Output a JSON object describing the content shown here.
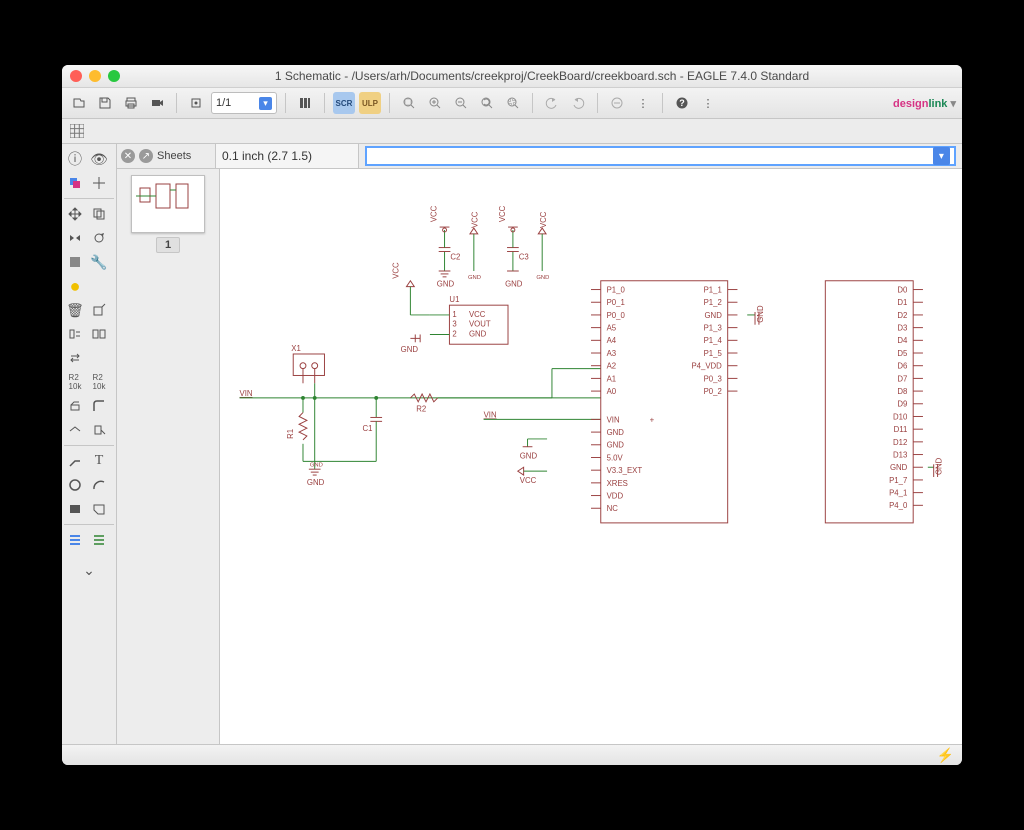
{
  "window": {
    "title": "1 Schematic - /Users/arh/Documents/creekproj/CreekBoard/creekboard.sch - EAGLE 7.4.0 Standard"
  },
  "toolbar": {
    "sheet_selector": "1/1",
    "designlink_label": "designlink"
  },
  "sheets": {
    "header": "Sheets",
    "current": "1"
  },
  "coord": {
    "text": "0.1 inch (2.7 1.5)"
  },
  "command": {
    "value": ""
  },
  "schematic": {
    "nets": [
      "VCC",
      "GND",
      "VIN"
    ],
    "parts": {
      "X1": "X1",
      "U1": "U1",
      "C1": "C1",
      "C2": "C2",
      "C3": "C3",
      "R1": "R1",
      "R2": "R2"
    },
    "u1_pins": [
      "VCC",
      "VOUT",
      "GND"
    ],
    "u1_pin_nums": [
      "1",
      "3",
      "2"
    ],
    "ic1_left": [
      "P1_0",
      "P0_1",
      "P0_0",
      "A5",
      "A4",
      "A3",
      "A2",
      "A1",
      "A0",
      "",
      "VIN",
      "GND",
      "GND",
      "5.0V",
      "V3.3_EXT",
      "XRES",
      "VDD",
      "NC"
    ],
    "ic1_right": [
      "P1_1",
      "P1_2",
      "GND",
      "P1_3",
      "P1_4",
      "P1_5",
      "P4_VDD",
      "P0_3",
      "P0_2"
    ],
    "ic1_bot_right": [],
    "ic2_right": [
      "D0",
      "D1",
      "D2",
      "D3",
      "D4",
      "D5",
      "D6",
      "D7",
      "D8",
      "D9",
      "D10",
      "D11",
      "D12",
      "D13",
      "GND",
      "P1_7",
      "P4_1",
      "P4_0"
    ],
    "vin_label": "VIN",
    "gnd_label": "GND",
    "vcc_label": "VCC",
    "extra_vin": "VIN",
    "plus": "+"
  }
}
